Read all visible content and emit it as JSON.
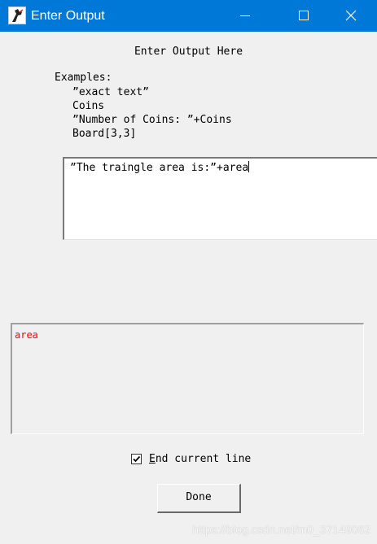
{
  "window": {
    "title": "Enter Output",
    "controls": {
      "minimize_icon": "minimize-icon",
      "maximize_icon": "maximize-icon",
      "close_icon": "close-icon"
    }
  },
  "dialog": {
    "heading": "Enter Output Here",
    "examples_title": "Examples:",
    "examples": [
      "”exact text”",
      "Coins",
      "”Number of Coins: ”+Coins",
      "Board[3,3]"
    ],
    "output_value": "”The traingle area is:”+area",
    "variables_text": "area",
    "variables_color": "#ff0000",
    "checkbox": {
      "checked": true,
      "label_accel": "E",
      "label_rest": "nd current line"
    },
    "done_label": "Done"
  },
  "colors": {
    "titlebar": "#0078d7",
    "variable_text": "#ff0000"
  },
  "watermark": "https://blog.csdn.net/m0_37149062"
}
